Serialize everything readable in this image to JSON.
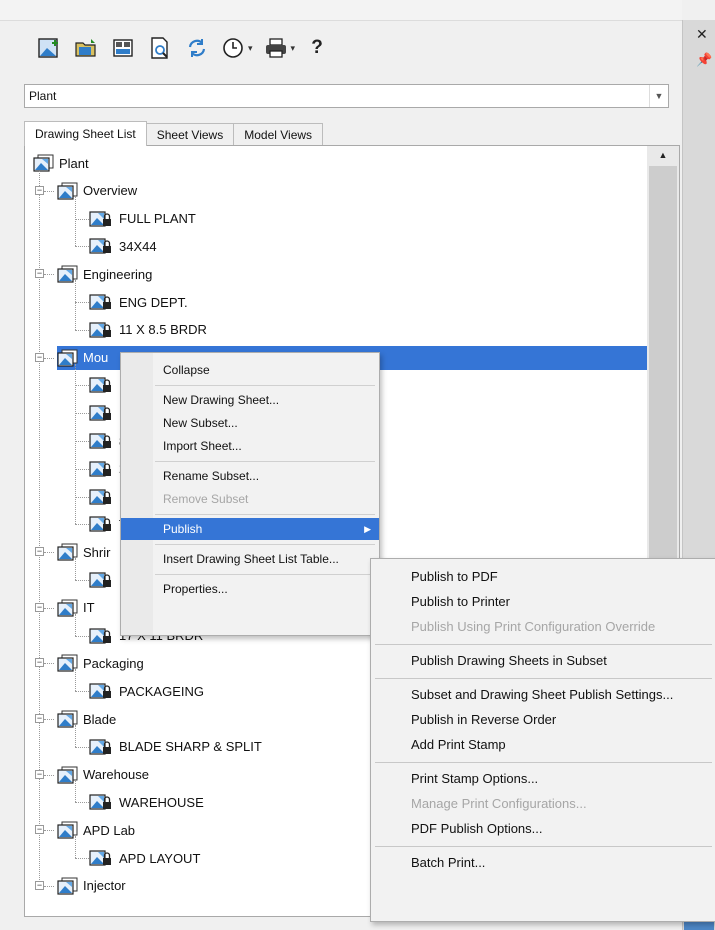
{
  "palette": {
    "selection": "#3575d6",
    "window": "#f0f0f0",
    "panel": "#ffffff",
    "disabled": "#a6a6a6"
  },
  "window_controls": {
    "close_glyph": "✕",
    "pin_glyph": "📌"
  },
  "toolbar": {
    "buttons": [
      {
        "icon": "new-sheet-icon"
      },
      {
        "icon": "open-folder-icon"
      },
      {
        "icon": "sheet-views-icon"
      },
      {
        "icon": "preview-icon"
      },
      {
        "icon": "refresh-icon"
      },
      {
        "icon": "clock-dropdown-icon",
        "caret": "▾"
      },
      {
        "icon": "printer-dropdown-icon",
        "caret": "▾"
      }
    ],
    "help_label": "?"
  },
  "sheet_set": {
    "selected": "Plant"
  },
  "tabs": [
    {
      "label": "Drawing Sheet List",
      "active": true
    },
    {
      "label": "Sheet Views",
      "active": false
    },
    {
      "label": "Model Views",
      "active": false
    }
  ],
  "tree": {
    "root": {
      "label": "Plant"
    },
    "expand_glyph": "−",
    "nodes": [
      {
        "type": "subset",
        "label": "Overview"
      },
      {
        "type": "sheet",
        "label": "FULL PLANT"
      },
      {
        "type": "sheet",
        "label": "34X44"
      },
      {
        "type": "subset",
        "label": "Engineering"
      },
      {
        "type": "sheet",
        "label": "ENG DEPT."
      },
      {
        "type": "sheet",
        "label": "11 X 8.5 BRDR"
      },
      {
        "type": "subset",
        "label": "Mou",
        "selected": true
      },
      {
        "type": "sheet",
        "label": "N"
      },
      {
        "type": "sheet",
        "label": "F"
      },
      {
        "type": "sheet",
        "label": "8"
      },
      {
        "type": "sheet",
        "label": "2"
      },
      {
        "type": "sheet",
        "label": "1"
      },
      {
        "type": "sheet",
        "label": "T"
      },
      {
        "type": "subset",
        "label": "Shrir"
      },
      {
        "type": "sheet",
        "label": "1"
      },
      {
        "type": "subset",
        "label": "IT"
      },
      {
        "type": "sheet",
        "label": "17 X 11 BRDR"
      },
      {
        "type": "subset",
        "label": "Packaging"
      },
      {
        "type": "sheet",
        "label": "PACKAGEING"
      },
      {
        "type": "subset",
        "label": "Blade"
      },
      {
        "type": "sheet",
        "label": "BLADE SHARP & SPLIT"
      },
      {
        "type": "subset",
        "label": "Warehouse"
      },
      {
        "type": "sheet",
        "label": "WAREHOUSE"
      },
      {
        "type": "subset",
        "label": "APD Lab"
      },
      {
        "type": "sheet",
        "label": "APD LAYOUT"
      },
      {
        "type": "subset",
        "label": "Injector"
      }
    ]
  },
  "context_menu": {
    "items": [
      {
        "label": "Collapse"
      },
      {
        "sep": true
      },
      {
        "label": "New Drawing Sheet..."
      },
      {
        "label": "New Subset..."
      },
      {
        "label": "Import Sheet..."
      },
      {
        "sep": true
      },
      {
        "label": "Rename Subset..."
      },
      {
        "label": "Remove Subset",
        "disabled": true
      },
      {
        "sep": true
      },
      {
        "label": "Publish",
        "highlighted": true,
        "submenu_glyph": "▶"
      },
      {
        "sep": true
      },
      {
        "label": "Insert Drawing Sheet List Table..."
      },
      {
        "sep": true
      },
      {
        "label": "Properties..."
      }
    ]
  },
  "publish_submenu": {
    "items": [
      {
        "label": "Publish to PDF"
      },
      {
        "label": "Publish to Printer"
      },
      {
        "label": "Publish Using Print Configuration Override",
        "disabled": true
      },
      {
        "sep": true
      },
      {
        "label": "Publish Drawing Sheets in Subset"
      },
      {
        "sep": true
      },
      {
        "label": "Subset and Drawing Sheet Publish Settings..."
      },
      {
        "label": "Publish in Reverse Order"
      },
      {
        "label": "Add Print Stamp"
      },
      {
        "sep": true
      },
      {
        "label": "Print Stamp Options..."
      },
      {
        "label": "Manage Print Configurations...",
        "disabled": true
      },
      {
        "label": "PDF Publish Options..."
      },
      {
        "sep": true
      },
      {
        "label": "Batch Print..."
      }
    ]
  }
}
